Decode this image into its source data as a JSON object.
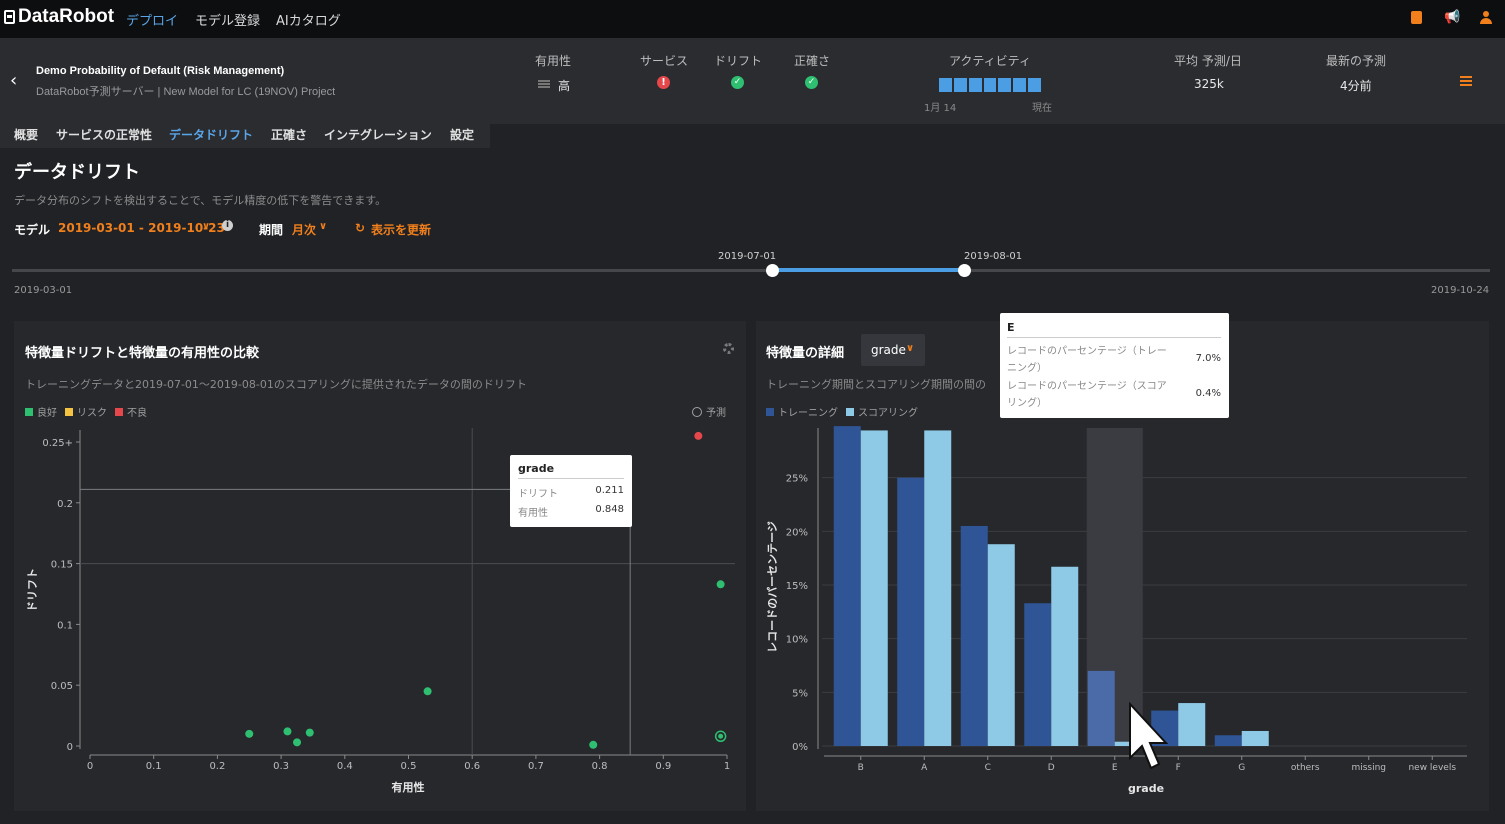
{
  "topbar": {
    "brand": "DataRobot",
    "nav": [
      "デプロイ",
      "モデル登録",
      "AIカタログ"
    ]
  },
  "header": {
    "title": "Demo Probability of Default (Risk Management)",
    "subtitle": "DataRobot予測サーバー | New Model for LC (19NOV) Project",
    "metrics": {
      "usefulness_label": "有用性",
      "usefulness_value": "高",
      "service_label": "サービス",
      "drift_label": "ドリフト",
      "accuracy_label": "正確さ",
      "activity_label": "アクティビティ",
      "activity_start": "1月 14",
      "activity_end": "現在",
      "avg_label": "平均 予測/日",
      "avg_value": "325k",
      "latest_label": "最新の予測",
      "latest_value": "4分前"
    }
  },
  "tabs": [
    "概要",
    "サービスの正常性",
    "データドリフト",
    "正確さ",
    "インテグレーション",
    "設定"
  ],
  "page": {
    "title": "データドリフト",
    "description": "データ分布のシフトを検出することで、モデル精度の低下を警告できます。",
    "model_label": "モデル",
    "model_range": "2019-03-01 - 2019-10-23",
    "period_label": "期間",
    "period_value": "月次",
    "refresh_label": "表示を更新"
  },
  "slider": {
    "start": "2019-03-01",
    "end": "2019-10-24",
    "sel_start": "2019-07-01",
    "sel_end": "2019-08-01"
  },
  "left_panel": {
    "title": "特徴量ドリフトと特徴量の有用性の比較",
    "subtitle": "トレーニングデータと2019-07-01～2019-08-01のスコアリングに提供されたデータの間のドリフト",
    "legend": [
      "良好",
      "リスク",
      "不良"
    ],
    "predict_label": "予測",
    "tooltip": {
      "title": "grade",
      "drift_label": "ドリフト",
      "drift_value": "0.211",
      "useful_label": "有用性",
      "useful_value": "0.848"
    }
  },
  "right_panel": {
    "title": "特徴量の詳細",
    "select_value": "grade",
    "subtitle": "トレーニング期間とスコアリング期間の間の",
    "legend": [
      "トレーニング",
      "スコアリング"
    ],
    "tooltip": {
      "title": "E",
      "row1_label": "レコードのパーセンテージ（トレーニング）",
      "row1_value": "7.0%",
      "row2_label": "レコードのパーセンテージ（スコアリング）",
      "row2_value": "0.4%"
    }
  },
  "colors": {
    "good": "#2fbf71",
    "risk": "#f5c342",
    "bad": "#e5474b",
    "training": "#2f5597",
    "scoring": "#8ecae6",
    "accent": "#f07f1c",
    "link": "#5aa5e8"
  },
  "chart_data": [
    {
      "type": "scatter",
      "xlabel": "有用性",
      "ylabel": "ドリフト",
      "xlim": [
        0,
        1
      ],
      "ylim": [
        0,
        0.25
      ],
      "xticks": [
        "0",
        "0.1",
        "0.2",
        "0.3",
        "0.4",
        "0.5",
        "0.6",
        "0.7",
        "0.8",
        "0.9",
        "1"
      ],
      "yticks": [
        "0",
        "0.05",
        "0.1",
        "0.15",
        "0.2",
        "0.25+"
      ],
      "points": [
        {
          "x": 0.25,
          "y": 0.01,
          "status": "good"
        },
        {
          "x": 0.31,
          "y": 0.012,
          "status": "good"
        },
        {
          "x": 0.325,
          "y": 0.003,
          "status": "good"
        },
        {
          "x": 0.345,
          "y": 0.011,
          "status": "good"
        },
        {
          "x": 0.53,
          "y": 0.045,
          "status": "good"
        },
        {
          "x": 0.79,
          "y": 0.001,
          "status": "good"
        },
        {
          "x": 0.99,
          "y": 0.133,
          "status": "good"
        },
        {
          "x": 0.955,
          "y": 0.255,
          "status": "bad"
        },
        {
          "x": 0.99,
          "y": 0.008,
          "status": "target"
        }
      ],
      "threshold_x": 0.6,
      "threshold_y": 0.15,
      "highlight": {
        "x": 0.848,
        "y": 0.211
      }
    },
    {
      "type": "bar",
      "xlabel": "grade",
      "ylabel": "レコードのパーセンテージ",
      "ylim": [
        0,
        30
      ],
      "yticks": [
        "0%",
        "5%",
        "10%",
        "15%",
        "20%",
        "25%"
      ],
      "categories": [
        "B",
        "A",
        "C",
        "D",
        "E",
        "F",
        "G",
        "others",
        "missing",
        "new levels"
      ],
      "series": [
        {
          "name": "トレーニング",
          "values": [
            29.8,
            25.0,
            20.5,
            13.3,
            7.0,
            3.3,
            1.0,
            0,
            0,
            0
          ]
        },
        {
          "name": "スコアリング",
          "values": [
            29.4,
            29.4,
            18.8,
            16.7,
            0.4,
            4.0,
            1.4,
            0,
            0,
            0
          ]
        }
      ],
      "highlight_category": "E"
    }
  ]
}
